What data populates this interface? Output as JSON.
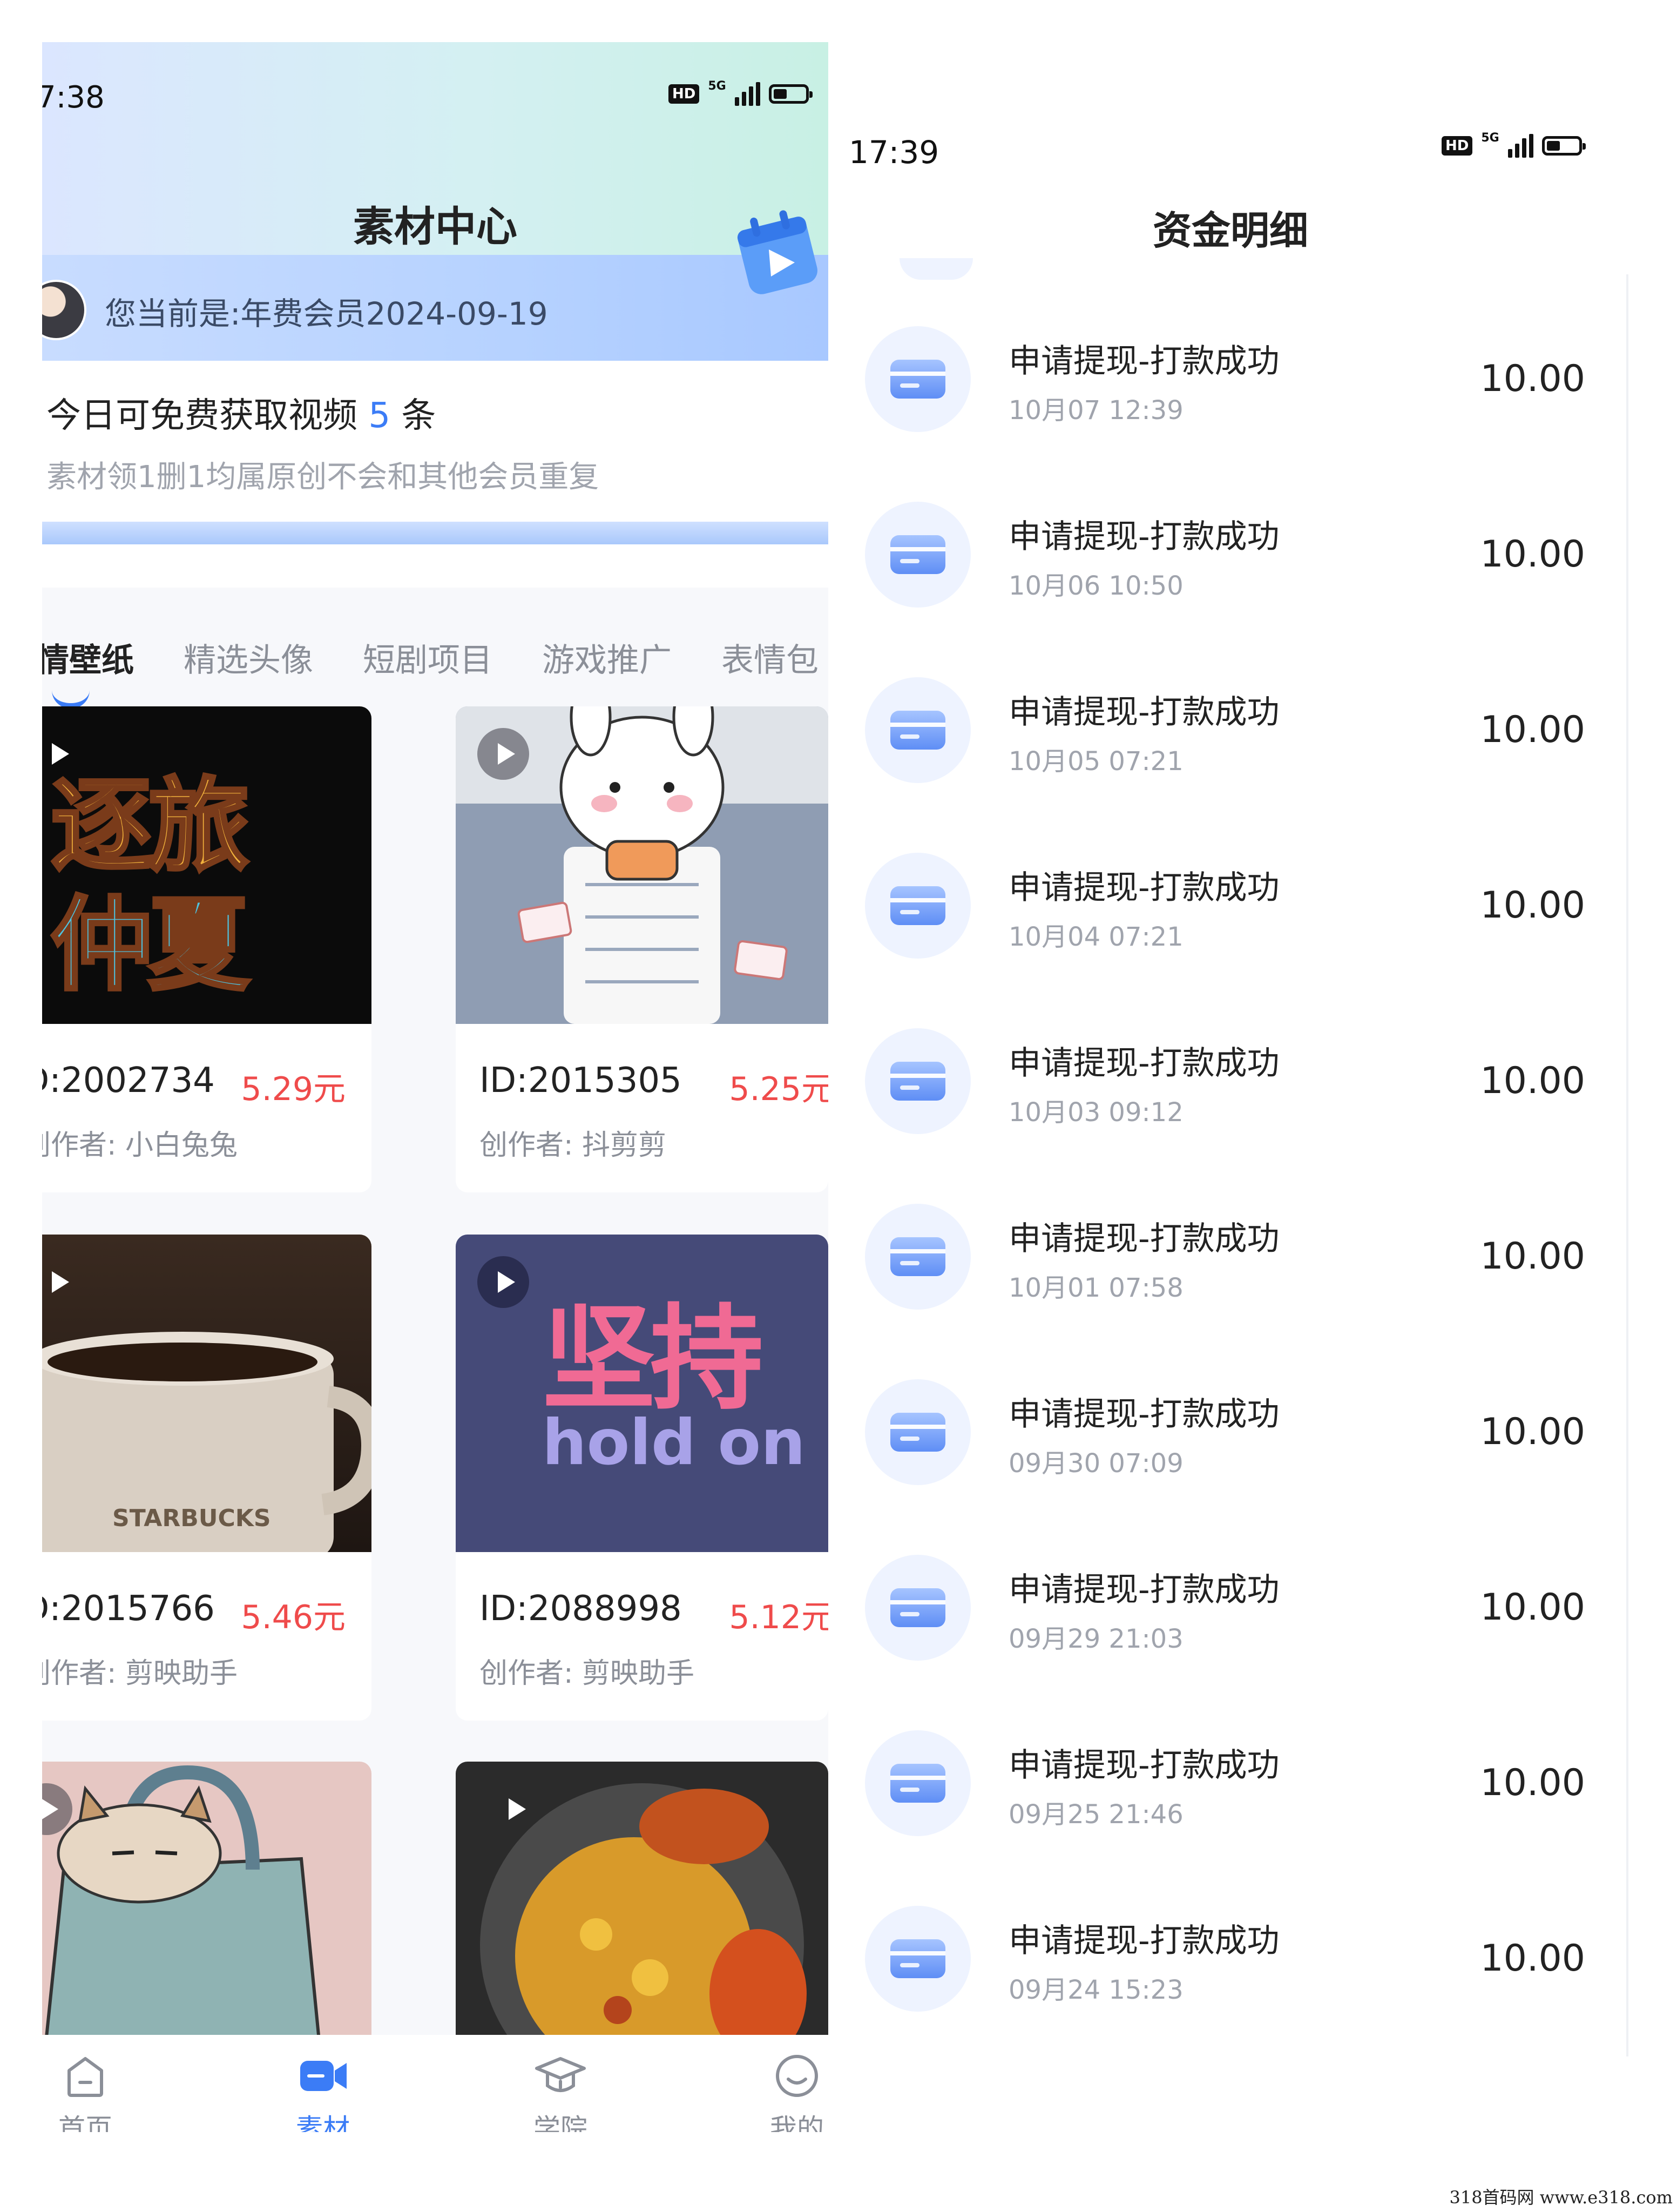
{
  "left": {
    "status_time": "7:38",
    "page_title": "素材中心",
    "member_text": "您当前是:年费会员2024-09-19",
    "free_prefix": "今日可免费获取视频",
    "free_count": "5",
    "free_suffix": "条",
    "free_sub": "素材领1删1均属原创不会和其他会员重复",
    "tabs": [
      "情壁纸",
      "精选头像",
      "短剧项目",
      "游戏推广",
      "表情包"
    ],
    "cards": [
      {
        "id": "D:2002734",
        "price": "5.29元",
        "author": "创作者: 小白兔兔",
        "thumb_text_1": "逐旅",
        "thumb_text_2": "仲夏"
      },
      {
        "id": "ID:2015305",
        "price": "5.25元",
        "author": "创作者: 抖剪剪"
      },
      {
        "id": "D:2015766",
        "price": "5.46元",
        "author": "创作者: 剪映助手",
        "mug_text": "STARBUCKS"
      },
      {
        "id": "ID:2088998",
        "price": "5.12元",
        "author": "创作者: 剪映助手",
        "thumb_text_1": "坚持",
        "thumb_text_2": "hold on"
      }
    ],
    "tabbar": [
      {
        "label": "首页",
        "icon": "home-icon"
      },
      {
        "label": "素材",
        "icon": "video-camera-icon"
      },
      {
        "label": "学院",
        "icon": "graduation-cap-icon"
      },
      {
        "label": "我的",
        "icon": "smile-face-icon"
      }
    ],
    "active_tab_color": "#3b7cf6"
  },
  "right": {
    "status_time": "17:39",
    "title": "资金明细",
    "records": [
      {
        "title": "申请提现-打款成功",
        "time": "10月07 12:39",
        "amount": "10.00"
      },
      {
        "title": "申请提现-打款成功",
        "time": "10月06 10:50",
        "amount": "10.00"
      },
      {
        "title": "申请提现-打款成功",
        "time": "10月05 07:21",
        "amount": "10.00"
      },
      {
        "title": "申请提现-打款成功",
        "time": "10月04 07:21",
        "amount": "10.00"
      },
      {
        "title": "申请提现-打款成功",
        "time": "10月03 09:12",
        "amount": "10.00"
      },
      {
        "title": "申请提现-打款成功",
        "time": "10月01 07:58",
        "amount": "10.00"
      },
      {
        "title": "申请提现-打款成功",
        "time": "09月30 07:09",
        "amount": "10.00"
      },
      {
        "title": "申请提现-打款成功",
        "time": "09月29 21:03",
        "amount": "10.00"
      },
      {
        "title": "申请提现-打款成功",
        "time": "09月25 21:46",
        "amount": "10.00"
      },
      {
        "title": "申请提现-打款成功",
        "time": "09月24 15:23",
        "amount": "10.00"
      }
    ]
  },
  "status_icons": {
    "hd": "HD",
    "network": "5G"
  },
  "watermark": "318首码网 www.e318.com"
}
